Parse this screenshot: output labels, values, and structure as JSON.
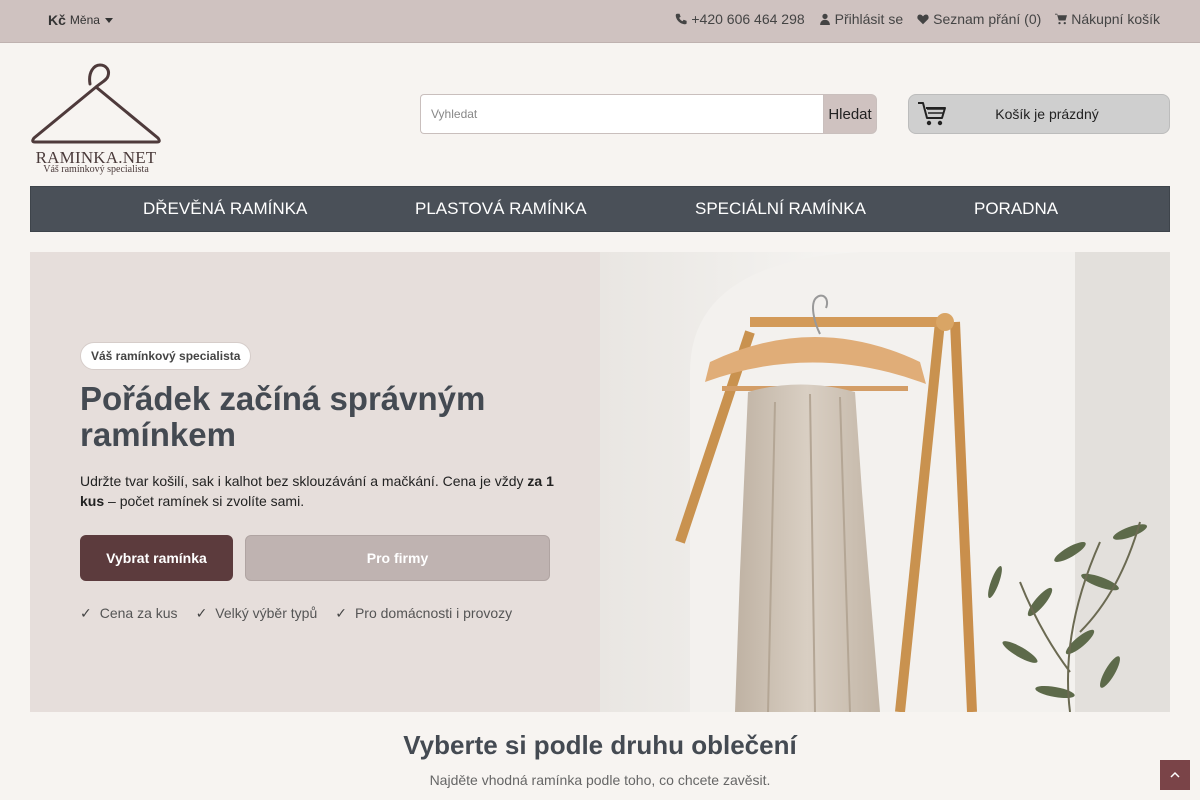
{
  "topbar": {
    "currency_symbol": "Kč",
    "currency_label": "Měna",
    "phone": "+420 606 464 298",
    "login": "Přihlásit se",
    "wishlist": "Seznam přání (0)",
    "cart_link": "Nákupní košík"
  },
  "header": {
    "logo_name": "RAMINKA.NET",
    "logo_tagline": "Váš ramínkový specialista",
    "search_placeholder": "Vyhledat",
    "search_button": "Hledat",
    "cart_status": "Košík je prázdný"
  },
  "nav": {
    "items": [
      "DŘEVĚNÁ RAMÍNKA",
      "PLASTOVÁ RAMÍNKA",
      "SPECIÁLNÍ RAMÍNKA",
      "PORADNA"
    ]
  },
  "hero": {
    "badge": "Váš ramínkový specialista",
    "title": "Pořádek začíná správným ramínkem",
    "text_part1": "Udržte tvar košilí, sak i kalhot bez sklouzávání a mačkání. Cena je vždy ",
    "text_bold": "za 1 kus",
    "text_part2": " – počet ramínek si zvolíte sami.",
    "primary_button": "Vybrat ramínka",
    "secondary_button": "Pro firmy",
    "checks": [
      "Cena za kus",
      "Velký výběr typů",
      "Pro domácnosti i provozy"
    ]
  },
  "section": {
    "title": "Vyberte si podle druhu oblečení",
    "subtitle": "Najděte vhodná ramínka podle toho, co chcete zavěsit."
  },
  "colors": {
    "topbar": "#cfc2c0",
    "nav": "#4a5058",
    "primary": "#5c3b3d",
    "hero_bg": "#e6dedb"
  }
}
